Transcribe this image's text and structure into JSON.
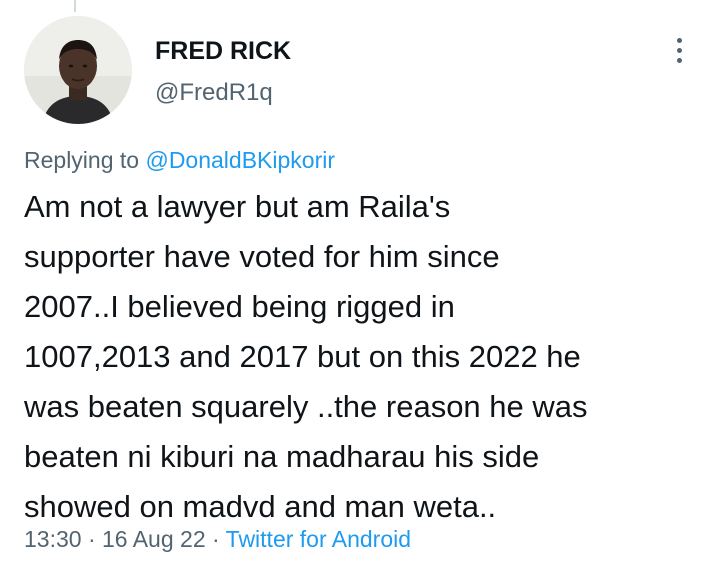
{
  "tweet": {
    "author": {
      "display_name": "FRED RICK",
      "handle": "@FredR1q",
      "avatar_icon": "person-avatar"
    },
    "reply": {
      "prefix": "Replying to",
      "mention": "@DonaldBKipkorir"
    },
    "text_lines": [
      "Am not a lawyer but am Raila's",
      "supporter have voted for him since",
      "2007..I believed being rigged in",
      "1007,2013 and 2017 but on this 2022 he",
      "was beaten squarely ..the reason he was",
      "beaten ni kiburi na madharau his side",
      "showed on madvd and man weta.."
    ],
    "meta": {
      "time": "13:30",
      "separator": "·",
      "date": "16 Aug 22",
      "source": "Twitter for Android"
    },
    "more_icon": "more-vertical-icon"
  },
  "colors": {
    "text": "#0f1419",
    "secondary": "#536471",
    "link": "#1d9bf0",
    "thread_line": "#cfd9de"
  }
}
